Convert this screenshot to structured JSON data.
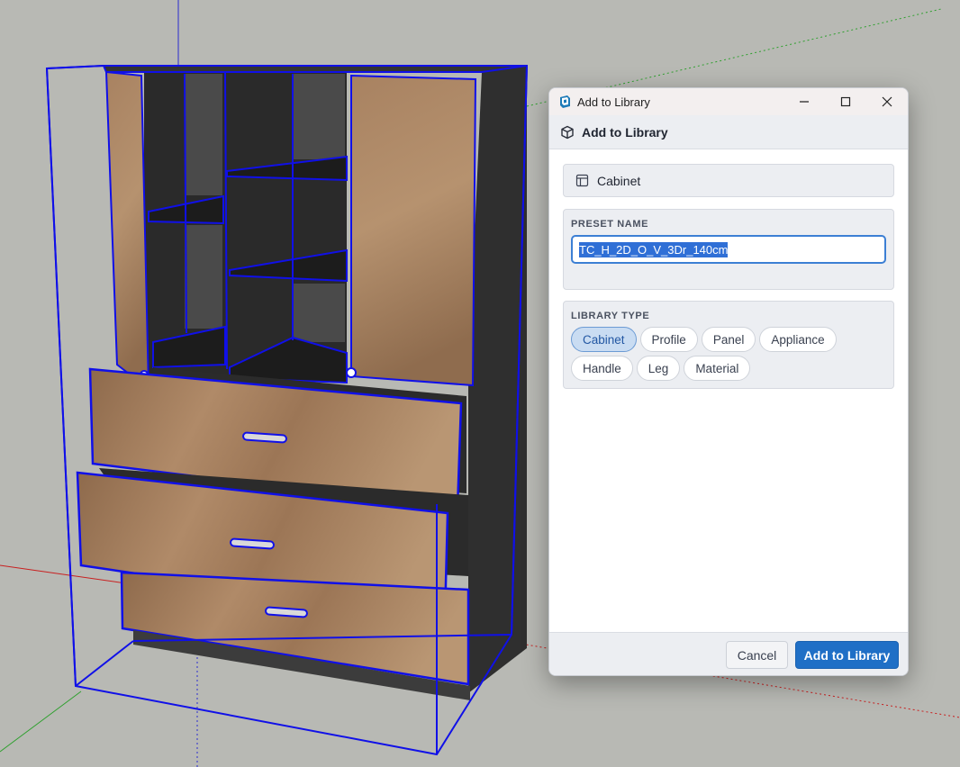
{
  "colors": {
    "viewport_background": "#b8b9b4",
    "selection_outline": "#1010e8",
    "wood": "#a67f5e",
    "cabinet_dark": "#2e2e2e",
    "accent": "#1f6fc6"
  },
  "dialog": {
    "window_title": "Add to Library",
    "app_icon": "sketchup-icon",
    "header_title": "Add to Library",
    "header_icon": "cube-icon",
    "type_card": {
      "icon": "layout-icon",
      "label": "Cabinet"
    },
    "preset": {
      "label": "PRESET NAME",
      "value": "TC_H_2D_O_V_3Dr_140cm"
    },
    "library_type": {
      "label": "LIBRARY TYPE",
      "options": [
        "Cabinet",
        "Profile",
        "Panel",
        "Appliance",
        "Handle",
        "Leg",
        "Material"
      ],
      "selected": "Cabinet"
    },
    "buttons": {
      "cancel": "Cancel",
      "add": "Add to Library"
    }
  }
}
